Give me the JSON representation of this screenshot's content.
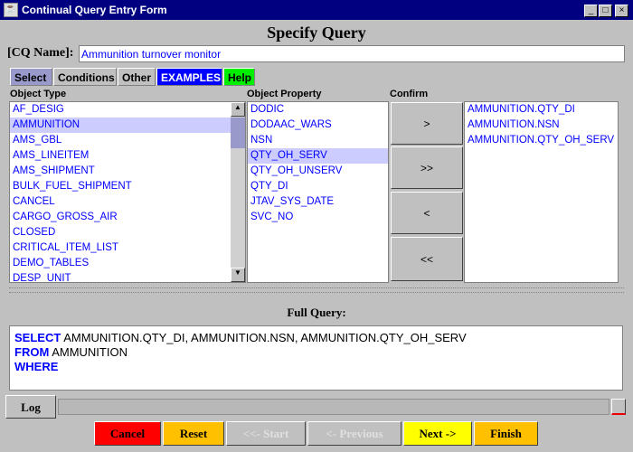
{
  "window": {
    "title": "Continual Query Entry Form",
    "controls": [
      "_",
      "□",
      "×"
    ]
  },
  "heading": "Specify Query",
  "cq_name": {
    "label": "[CQ Name]:",
    "value": "Ammunition turnover monitor"
  },
  "tabs": [
    {
      "label": "Select",
      "color": "#9999cc"
    },
    {
      "label": "Conditions",
      "color": "#c0c0c0"
    },
    {
      "label": "Other",
      "color": "#c0c0c0"
    },
    {
      "label": "EXAMPLES",
      "color": "#0000ff"
    },
    {
      "label": "Help",
      "color": "#00ee00"
    }
  ],
  "object_type": {
    "label": "Object Type",
    "items": [
      "AF_DESIG",
      "AMMUNITION",
      "AMS_GBL",
      "AMS_LINEITEM",
      "AMS_SHIPMENT",
      "BULK_FUEL_SHIPMENT",
      "CANCEL",
      "CARGO_GROSS_AIR",
      "CLOSED",
      "CRITICAL_ITEM_LIST",
      "DEMO_TABLES",
      "DESP_UNIT"
    ],
    "selected": 1
  },
  "object_property": {
    "label": "Object Property",
    "items": [
      "DODIC",
      "DODAAC_WARS",
      "NSN",
      "QTY_OH_SERV",
      "QTY_OH_UNSERV",
      "QTY_DI",
      "JTAV_SYS_DATE",
      "SVC_NO"
    ],
    "selected": 3
  },
  "confirm": {
    "label": "Confirm",
    "buttons": [
      ">",
      ">>",
      "<",
      "<<"
    ],
    "items": [
      "AMMUNITION.QTY_DI",
      "AMMUNITION.NSN",
      "AMMUNITION.QTY_OH_SERV"
    ]
  },
  "full_query": {
    "label": "Full Query:",
    "select_kw": "SELECT",
    "select_val": "AMMUNITION.QTY_DI, AMMUNITION.NSN, AMMUNITION.QTY_OH_SERV",
    "from_kw": "FROM",
    "from_val": "AMMUNITION",
    "where_kw": "WHERE"
  },
  "log_label": "Log",
  "nav": [
    {
      "label": "Cancel",
      "color": "#ff0000"
    },
    {
      "label": "Reset",
      "color": "#ffc000"
    },
    {
      "label": "<<- Start",
      "color": "#c0c0c0"
    },
    {
      "label": "<- Previous",
      "color": "#c0c0c0"
    },
    {
      "label": "Next ->",
      "color": "#ffff00"
    },
    {
      "label": "Finish",
      "color": "#ffc000"
    }
  ]
}
